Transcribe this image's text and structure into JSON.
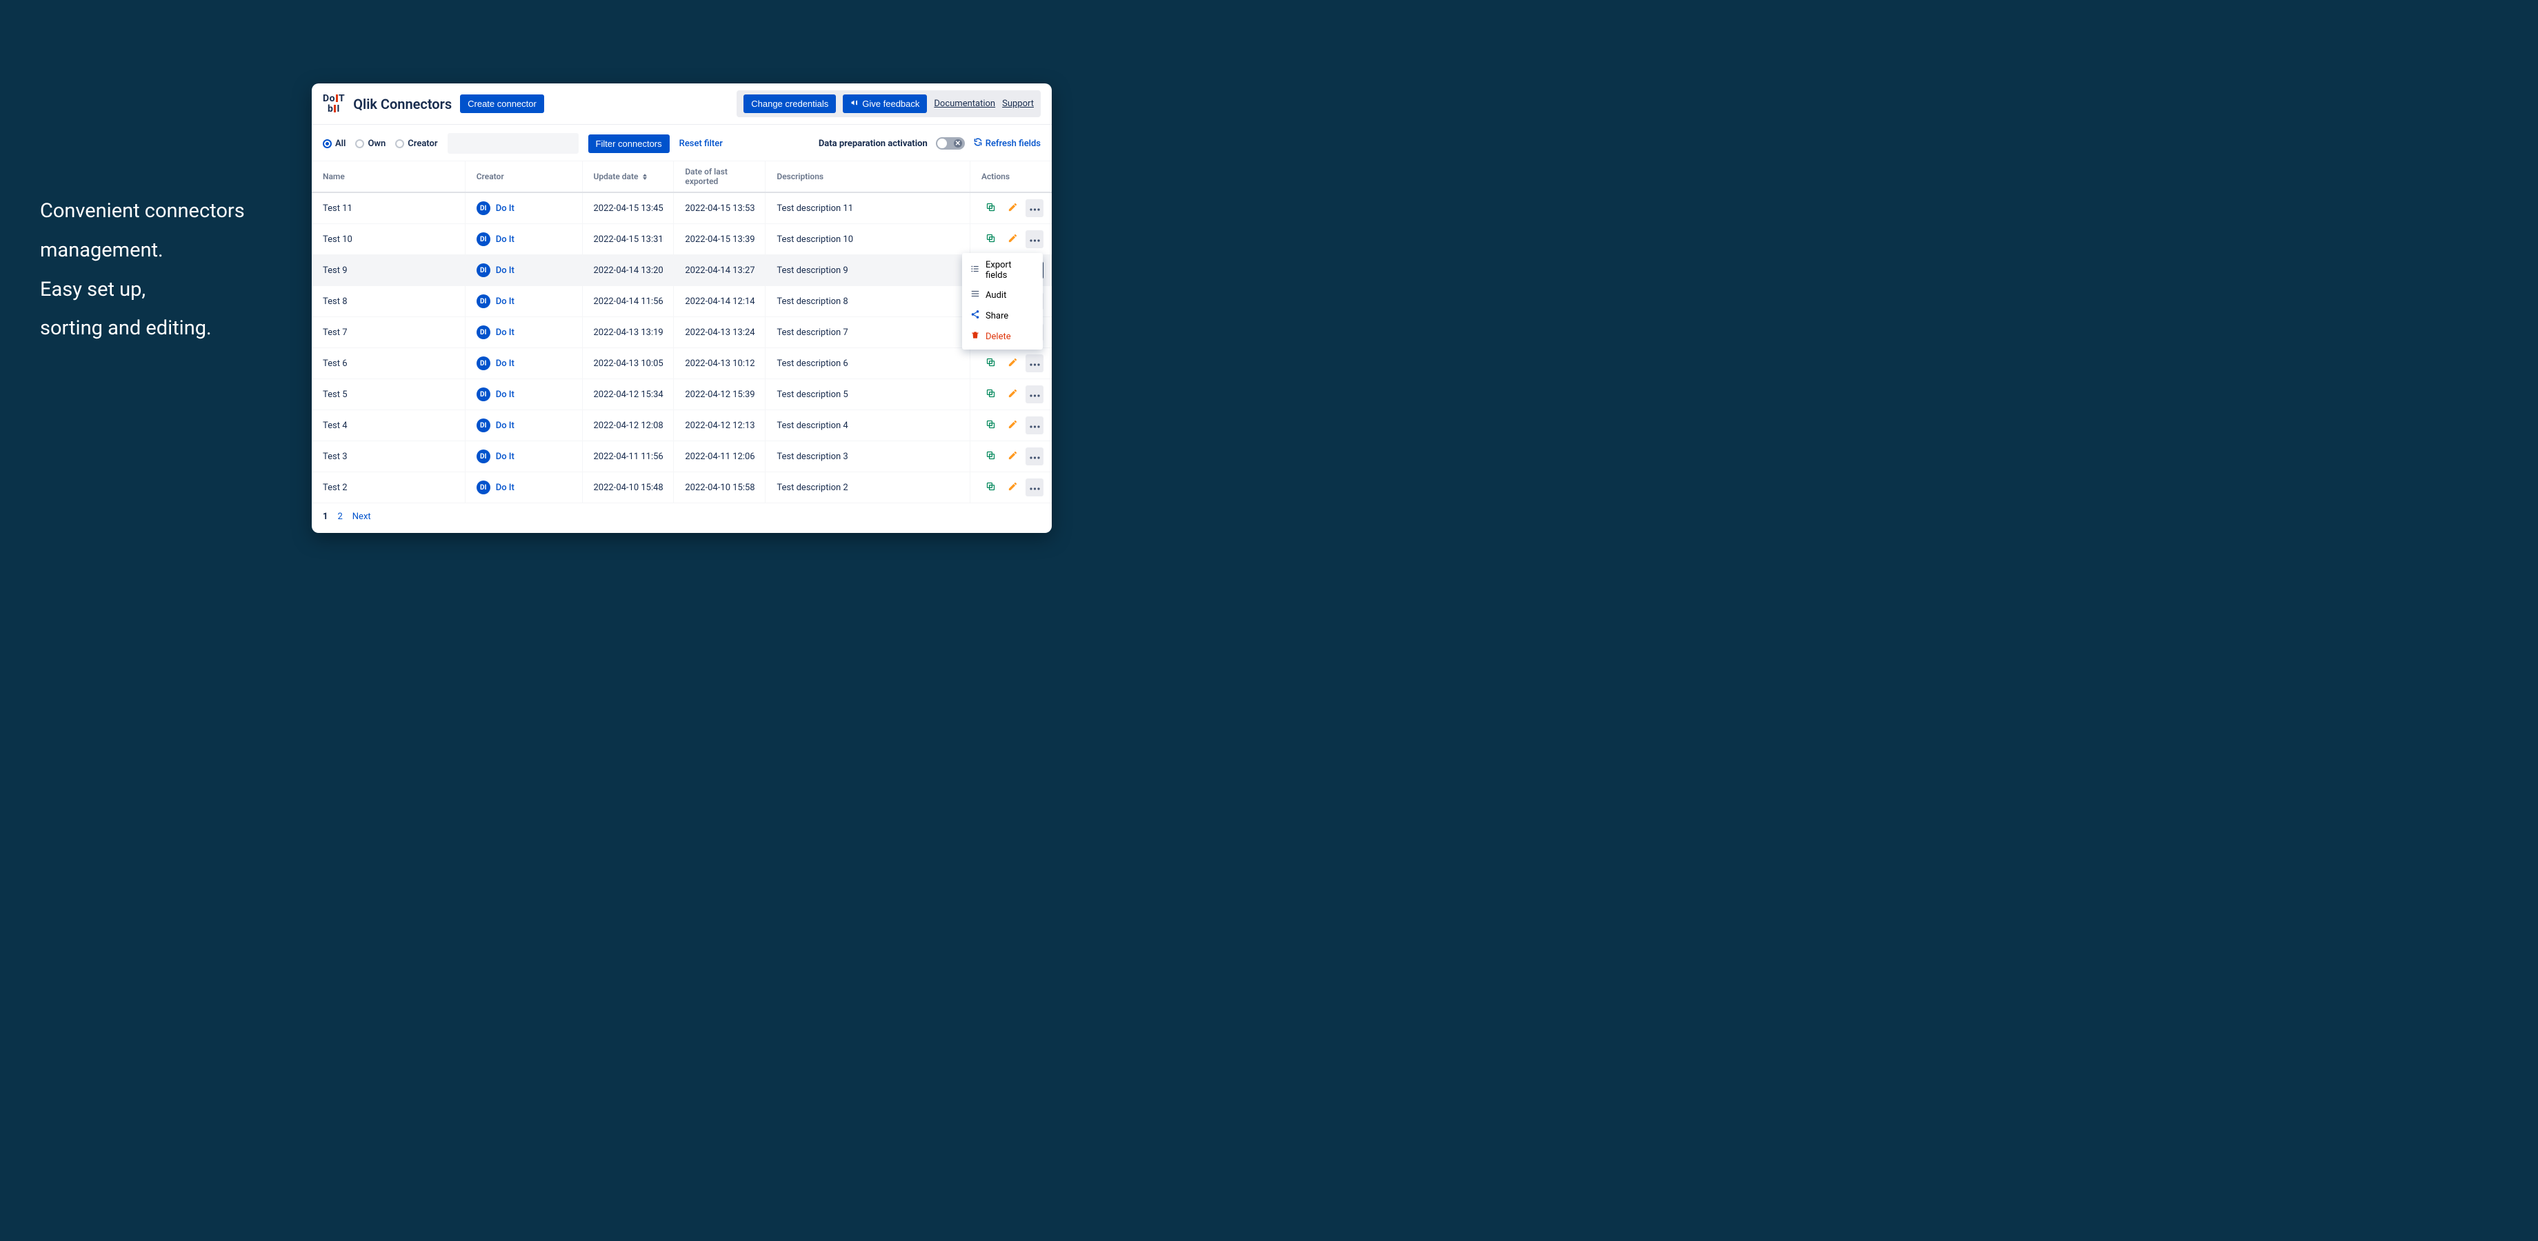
{
  "marketing": {
    "line1": "Convenient connectors",
    "line2": "management.",
    "line3": "Easy set up,",
    "line4": "sorting and editing."
  },
  "header": {
    "logo_top": "Do",
    "logo_bottom": "b",
    "logo_t": "T",
    "logo_i": "I",
    "title": "Qlik Connectors",
    "create_btn": "Create connector",
    "change_credentials": "Change credentials",
    "give_feedback": "Give feedback",
    "documentation": "Documentation",
    "support": "Support"
  },
  "toolbar": {
    "radio_all": "All",
    "radio_own": "Own",
    "radio_creator": "Creator",
    "filter_btn": "Filter connectors",
    "reset_filter": "Reset filter",
    "data_prep_label": "Data preparation activation",
    "refresh": "Refresh fields"
  },
  "columns": {
    "name": "Name",
    "creator": "Creator",
    "update": "Update date",
    "export": "Date of last exported",
    "desc": "Descriptions",
    "actions": "Actions"
  },
  "creator": {
    "initials": "DI",
    "name": "Do It"
  },
  "rows": [
    {
      "name": "Test 11",
      "update": "2022-04-15 13:45",
      "export": "2022-04-15 13:53",
      "desc": "Test description 11"
    },
    {
      "name": "Test 10",
      "update": "2022-04-15 13:31",
      "export": "2022-04-15 13:39",
      "desc": "Test description 10"
    },
    {
      "name": "Test 9",
      "update": "2022-04-14 13:20",
      "export": "2022-04-14 13:27",
      "desc": "Test description 9"
    },
    {
      "name": "Test 8",
      "update": "2022-04-14 11:56",
      "export": "2022-04-14 12:14",
      "desc": "Test description 8"
    },
    {
      "name": "Test 7",
      "update": "2022-04-13 13:19",
      "export": "2022-04-13 13:24",
      "desc": "Test description 7"
    },
    {
      "name": "Test 6",
      "update": "2022-04-13 10:05",
      "export": "2022-04-13 10:12",
      "desc": "Test description 6"
    },
    {
      "name": "Test 5",
      "update": "2022-04-12 15:34",
      "export": "2022-04-12 15:39",
      "desc": "Test description 5"
    },
    {
      "name": "Test 4",
      "update": "2022-04-12 12:08",
      "export": "2022-04-12 12:13",
      "desc": "Test description 4"
    },
    {
      "name": "Test 3",
      "update": "2022-04-11 11:56",
      "export": "2022-04-11 12:06",
      "desc": "Test description 3"
    },
    {
      "name": "Test 2",
      "update": "2022-04-10 15:48",
      "export": "2022-04-10 15:58",
      "desc": "Test description 2"
    }
  ],
  "dropdown": {
    "export_fields": "Export fields",
    "audit": "Audit",
    "share": "Share",
    "delete": "Delete"
  },
  "pagination": {
    "current": "1",
    "p2": "2",
    "next": "Next"
  },
  "highlight_row": 2,
  "active_more_row": 2
}
